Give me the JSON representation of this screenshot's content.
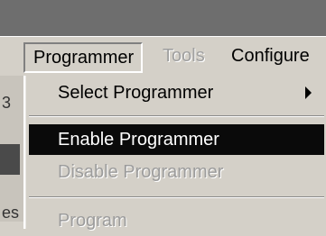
{
  "menubar": {
    "menus": [
      {
        "label": "Programmer",
        "state": "open"
      },
      {
        "label": "Tools",
        "state": "disabled"
      },
      {
        "label": "Configure",
        "state": "normal"
      }
    ]
  },
  "left_fragments": {
    "top": "3",
    "bottom": "es"
  },
  "dropdown": {
    "items": [
      {
        "label": "Select Programmer",
        "has_submenu": true,
        "state": "normal"
      },
      {
        "label": "Enable Programmer",
        "state": "selected"
      },
      {
        "label": "Disable Programmer",
        "state": "disabled"
      },
      {
        "label": "Program",
        "state": "disabled"
      }
    ]
  },
  "colors": {
    "menu_face": "#d4d0c8",
    "selection_bg": "#0a0a0a",
    "selection_text": "#ffffff",
    "disabled_text": "#9c9c9c"
  }
}
